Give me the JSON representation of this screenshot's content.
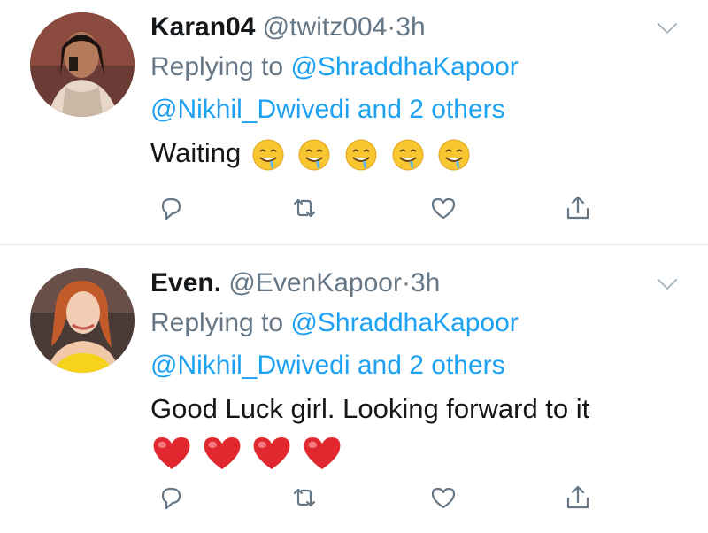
{
  "tweets": [
    {
      "name": "Karan04",
      "handle": "@twitz004",
      "dot": "·",
      "time": "3h",
      "replying_prefix": "Replying to",
      "mention_1": "@ShraddhaKapoor",
      "mention_2": "@Nikhil_Dwivedi",
      "and_others": "and 2 others",
      "text": "Waiting",
      "emoji_name": "drooling-face",
      "emoji_count": 5
    },
    {
      "name": "Even.",
      "handle": "@EvenKapoor",
      "dot": "·",
      "time": "3h",
      "replying_prefix": "Replying to",
      "mention_1": "@ShraddhaKapoor",
      "mention_2": "@Nikhil_Dwivedi",
      "and_others": "and 2 others",
      "text": "Good Luck girl. Looking forward to it",
      "emoji_name": "red-heart",
      "emoji_count": 4
    }
  ],
  "colors": {
    "link": "#1da1f2",
    "secondary": "#657786",
    "primary": "#14171a",
    "divider": "#e1e8ed"
  },
  "icons": [
    "chevron-down-icon",
    "reply-icon",
    "retweet-icon",
    "like-icon",
    "share-icon"
  ]
}
